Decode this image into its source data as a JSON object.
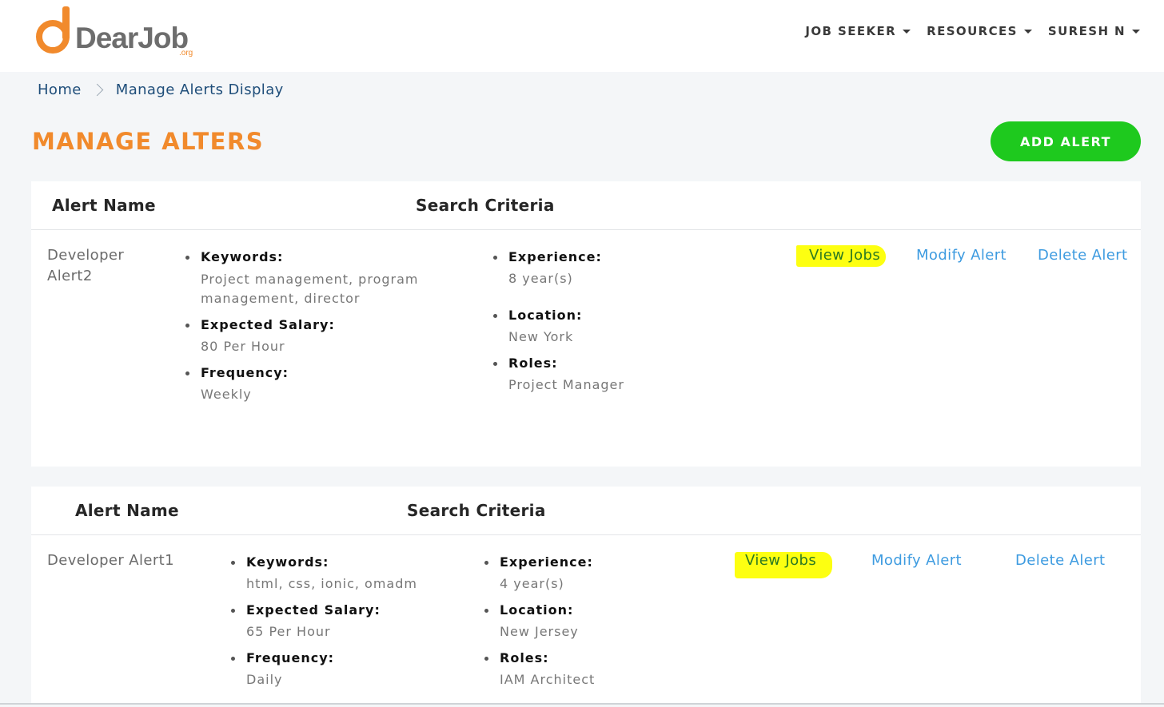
{
  "header": {
    "logo_text": "DearJob",
    "logo_sub": ".org",
    "nav": [
      {
        "label": "JOB SEEKER"
      },
      {
        "label": "RESOURCES"
      },
      {
        "label": "SURESH N"
      }
    ]
  },
  "breadcrumb": {
    "home": "Home",
    "current": "Manage Alerts Display"
  },
  "page": {
    "title": "MANAGE ALTERS",
    "add_button": "ADD ALERT"
  },
  "table": {
    "col_alert_name": "Alert Name",
    "col_search_criteria": "Search Criteria"
  },
  "alerts": [
    {
      "name_line1": "Developer",
      "name_line2": "Alert2",
      "keywords_label": "Keywords:",
      "keywords_line1": "Project management, program",
      "keywords_line2": "management, director",
      "salary_label": "Expected Salary:",
      "salary": "80 Per Hour",
      "frequency_label": "Frequency:",
      "frequency": "Weekly",
      "experience_label": "Experience:",
      "experience": "8 year(s)",
      "location_label": "Location:",
      "location": "New York",
      "roles_label": "Roles:",
      "roles": "Project Manager",
      "view": "View Jobs",
      "modify": "Modify Alert",
      "delete": "Delete Alert"
    },
    {
      "name": "Developer Alert1",
      "keywords_label": "Keywords:",
      "keywords": "html, css, ionic, omadm",
      "salary_label": "Expected Salary:",
      "salary": "65 Per Hour",
      "frequency_label": "Frequency:",
      "frequency": "Daily",
      "experience_label": "Experience:",
      "experience": "4 year(s)",
      "location_label": "Location:",
      "location": "New Jersey",
      "roles_label": "Roles:",
      "roles": "IAM Architect",
      "view": "View Jobs",
      "modify": "Modify Alert",
      "delete": "Delete Alert"
    }
  ],
  "colors": {
    "brand_orange": "#f18a2c",
    "add_green": "#1ec91e",
    "link_blue": "#3d9be0",
    "highlight": "#fdff11"
  }
}
